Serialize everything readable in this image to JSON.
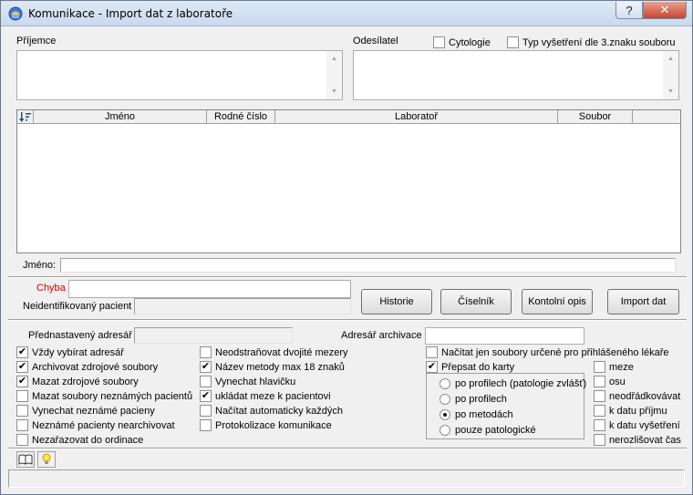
{
  "window": {
    "title": "Komunikace  - Import dat z laboratoře",
    "help_label": "?",
    "close_label": "✕"
  },
  "recipient": {
    "label": "Příjemce"
  },
  "sender": {
    "label": "Odesílatel",
    "cytology_label": "Cytologie",
    "cytology_checked": false,
    "exam_type_label": "Typ vyšetření dle 3.znaku souboru",
    "exam_type_checked": false
  },
  "grid": {
    "sort_icon": "sort-descending-icon",
    "columns": [
      "Jméno",
      "Rodné číslo",
      "Laboratoř",
      "Soubor"
    ]
  },
  "name_field": {
    "label": "Jméno:",
    "value": ""
  },
  "error": {
    "label": "Chyba",
    "value": "",
    "color": "#d40000"
  },
  "unidentified": {
    "label": "Neidentifikovaný pacient",
    "value": ""
  },
  "buttons": {
    "history": "Historie",
    "codebook": "Číselník",
    "control": "Kontolní opis",
    "import": "Import dat"
  },
  "default_dir": {
    "label": "Přednastavený adresář",
    "value": ""
  },
  "archive_dir": {
    "label": "Adresář archivace",
    "value": ""
  },
  "options_left": [
    {
      "label": "Vždy vybírat adresář",
      "checked": true
    },
    {
      "label": "Archivovat zdrojové soubory",
      "checked": true
    },
    {
      "label": "Mazat zdrojové soubory",
      "checked": true
    },
    {
      "label": "Mazat soubory neznámých pacientů",
      "checked": false
    },
    {
      "label": "Vynechat neznámé pacieny",
      "checked": false
    },
    {
      "label": "Neznámé pacienty nearchivovat",
      "checked": false
    },
    {
      "label": "Nezařazovat do ordinace",
      "checked": false
    }
  ],
  "options_mid": [
    {
      "label": "Neodstraňovat dvojité mezery",
      "checked": false
    },
    {
      "label": "Název metody max 18 znaků",
      "checked": true
    },
    {
      "label": "Vynechat hlavičku",
      "checked": false
    },
    {
      "label": "ukládat meze k pacientovi",
      "checked": true
    },
    {
      "label": "Načítat automaticky každých",
      "checked": false
    },
    {
      "label": "Protokolizace komunikace",
      "checked": false
    }
  ],
  "load_only_doctor": {
    "label": "Načítat jen soubory určené pro přihlášeného lékaře",
    "checked": false
  },
  "overwrite": {
    "label": "Přepsat do karty",
    "checked": true
  },
  "overwrite_modes": [
    {
      "label": "po profilech (patologie zvlášť)",
      "selected": false
    },
    {
      "label": "po profilech",
      "selected": false
    },
    {
      "label": "po metodách",
      "selected": true
    },
    {
      "label": "pouze patologické",
      "selected": false
    }
  ],
  "options_right": [
    {
      "label": "meze",
      "checked": false
    },
    {
      "label": "osu",
      "checked": false
    },
    {
      "label": "neodřádkovávat",
      "checked": false
    },
    {
      "label": "k datu příjmu",
      "checked": false
    },
    {
      "label": "k datu vyšetření",
      "checked": false
    },
    {
      "label": "nerozlišovat čas",
      "checked": false
    }
  ],
  "toolbar": {
    "book_icon": "book-icon",
    "hint_icon": "lightbulb-icon"
  }
}
